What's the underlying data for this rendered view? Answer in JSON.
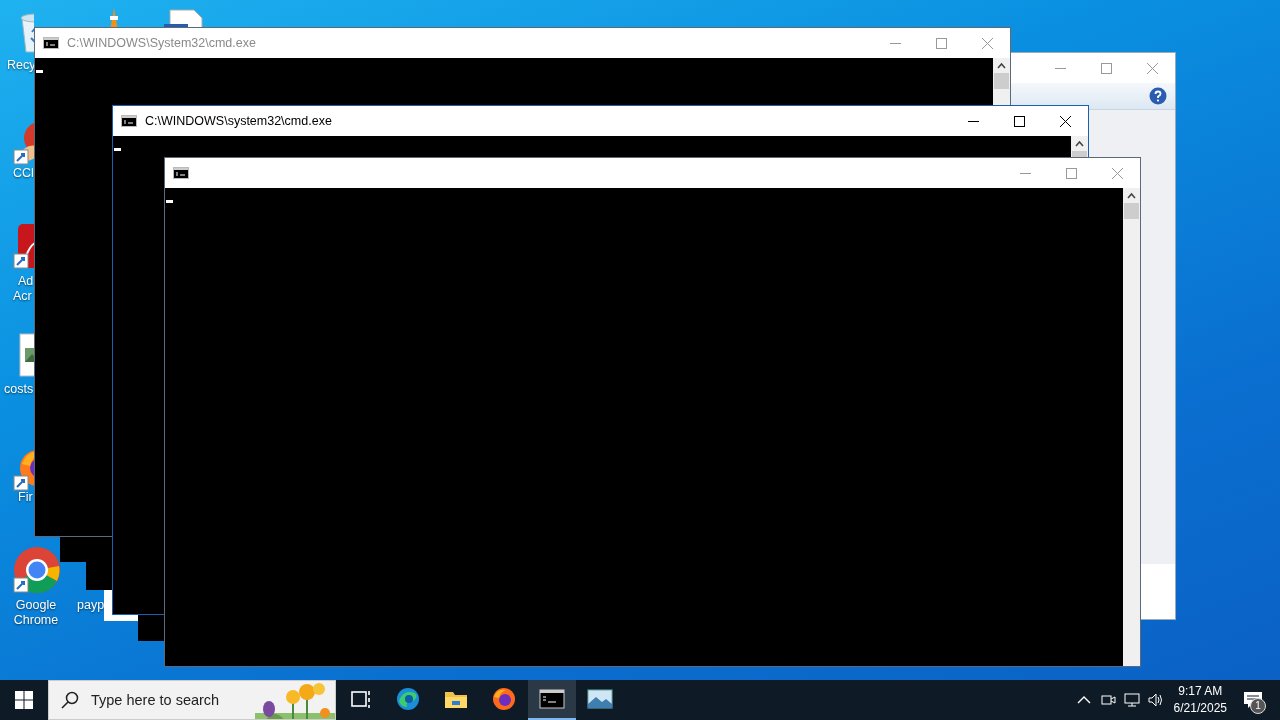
{
  "desktop_icons": [
    {
      "kind": "recycle-bin",
      "lines": [
        "Recy"
      ]
    },
    {
      "kind": "cone"
    },
    {
      "kind": "document"
    },
    {
      "kind": "cleaner",
      "lines": [
        "CCl"
      ]
    },
    {
      "kind": "acrobat",
      "lines": [
        "Ad",
        "Acr"
      ]
    },
    {
      "kind": "image-file",
      "lines": [
        "costs"
      ]
    },
    {
      "kind": "firefox",
      "lines": [
        "Fir"
      ]
    },
    {
      "kind": "chrome",
      "lines": [
        "Google",
        "Chrome"
      ]
    },
    {
      "kind": "none",
      "lines": [
        "payp"
      ]
    }
  ],
  "windows": [
    {
      "kind": "dialog",
      "active": false
    },
    {
      "kind": "console",
      "title": "C:\\WINDOWS\\System32\\cmd.exe",
      "active": false
    },
    {
      "kind": "console",
      "title": "C:\\WINDOWS\\system32\\cmd.exe",
      "active": true
    },
    {
      "kind": "console",
      "active": false
    }
  ],
  "taskbar": {
    "search": {
      "placeholder": "Type here to search"
    },
    "apps": [
      {
        "kind": "task-view",
        "selected": false
      },
      {
        "kind": "edge",
        "selected": false
      },
      {
        "kind": "folder",
        "selected": false
      },
      {
        "kind": "firefox",
        "selected": false
      },
      {
        "kind": "console",
        "selected": true
      },
      {
        "kind": "photos",
        "selected": false
      }
    ],
    "clock": {
      "time": "9:17 AM",
      "date": "6/21/2025"
    },
    "notifications": {
      "count": "1"
    }
  }
}
